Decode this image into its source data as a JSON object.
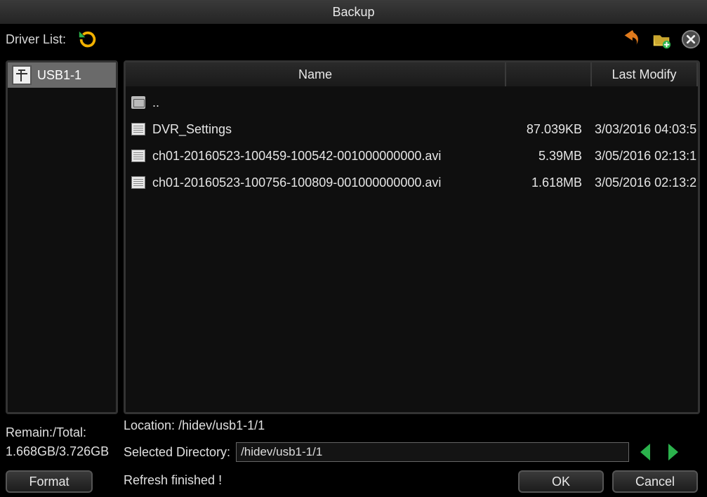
{
  "title": "Backup",
  "toolbar": {
    "driver_list_label": "Driver List:"
  },
  "driver_panel": {
    "items": [
      {
        "label": "USB1-1"
      }
    ]
  },
  "file_table": {
    "headers": {
      "name": "Name",
      "size": "",
      "date": "Last Modify"
    },
    "rows": [
      {
        "type": "up",
        "name": "..",
        "size": "",
        "date": ""
      },
      {
        "type": "file",
        "name": "DVR_Settings",
        "size": "87.039KB",
        "date": "3/03/2016 04:03:5"
      },
      {
        "type": "file",
        "name": "ch01-20160523-100459-100542-001000000000.avi",
        "size": "5.39MB",
        "date": "3/05/2016 02:13:1"
      },
      {
        "type": "file",
        "name": "ch01-20160523-100756-100809-001000000000.avi",
        "size": "1.618MB",
        "date": "3/05/2016 02:13:2"
      }
    ]
  },
  "storage": {
    "remain_total_label": "Remain:/Total:",
    "remain_total_value": "1.668GB/3.726GB"
  },
  "location": {
    "label": "Location:",
    "value": "/hidev/usb1-1/1"
  },
  "selected_dir": {
    "label": "Selected Directory:",
    "value": "/hidev/usb1-1/1"
  },
  "status": "Refresh finished !",
  "buttons": {
    "format": "Format",
    "ok": "OK",
    "cancel": "Cancel"
  }
}
